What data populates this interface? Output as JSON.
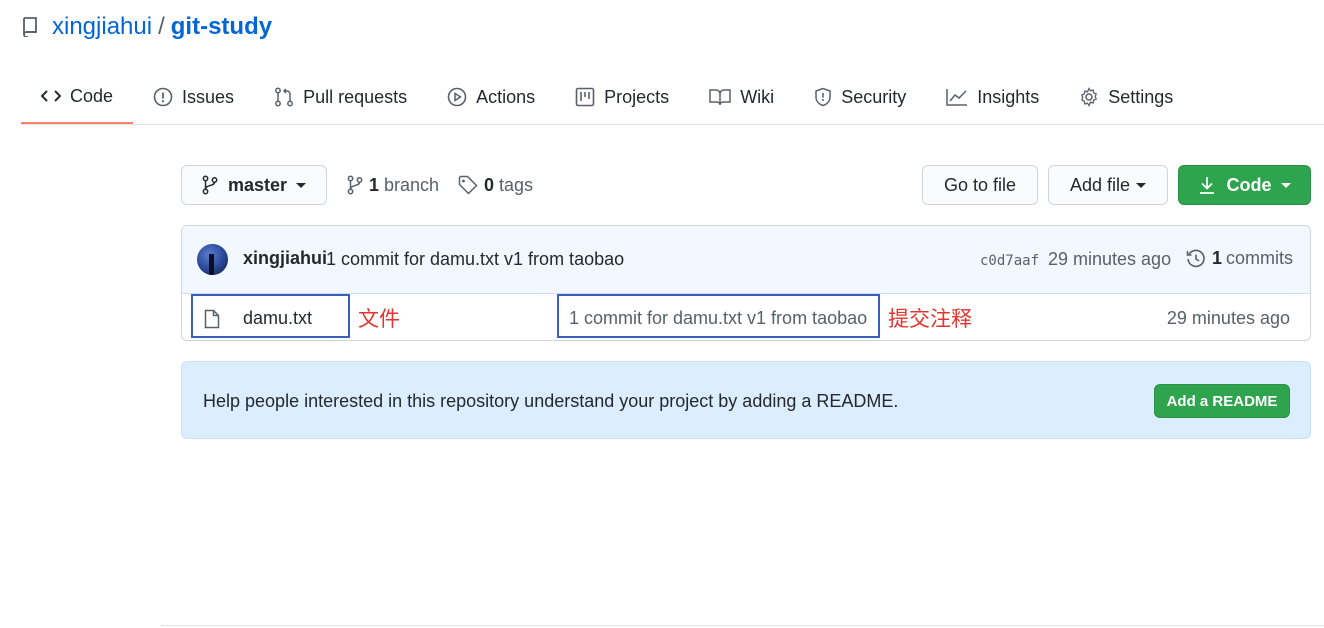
{
  "repo": {
    "owner": "xingjiahui",
    "separator": "/",
    "name": "git-study",
    "icon": "repo-icon"
  },
  "tabs": [
    {
      "label": "Code",
      "icon": "code-icon",
      "active": true
    },
    {
      "label": "Issues",
      "icon": "issue-icon"
    },
    {
      "label": "Pull requests",
      "icon": "pull-request-icon"
    },
    {
      "label": "Actions",
      "icon": "play-icon"
    },
    {
      "label": "Projects",
      "icon": "project-icon"
    },
    {
      "label": "Wiki",
      "icon": "book-icon"
    },
    {
      "label": "Security",
      "icon": "shield-icon"
    },
    {
      "label": "Insights",
      "icon": "graph-icon"
    },
    {
      "label": "Settings",
      "icon": "gear-icon"
    }
  ],
  "toolbar": {
    "branch": "master",
    "branch_count": "1",
    "branch_label": "branch",
    "tag_count": "0",
    "tag_label": "tags",
    "go_to_file": "Go to file",
    "add_file": "Add file",
    "code": "Code"
  },
  "latest_commit": {
    "author": "xingjiahui",
    "message": "1 commit for damu.txt v1 from taobao",
    "sha": "c0d7aaf",
    "time": "29 minutes ago",
    "count": "1",
    "count_label": "commits"
  },
  "files": [
    {
      "name": "damu.txt",
      "commit_message": "1 commit for damu.txt v1 from taobao",
      "time": "29 minutes ago",
      "icon": "file-icon"
    }
  ],
  "annotations": {
    "file_label": "文件",
    "commit_label": "提交注释",
    "box_color": "#3b5fc0",
    "text_color": "#e3342f"
  },
  "readme": {
    "text": "Help people interested in this repository understand your project by adding a README.",
    "button": "Add a README"
  },
  "colors": {
    "link": "#0366d6",
    "primary_button": "#2ea44f",
    "active_tab_underline": "#f9826c"
  }
}
